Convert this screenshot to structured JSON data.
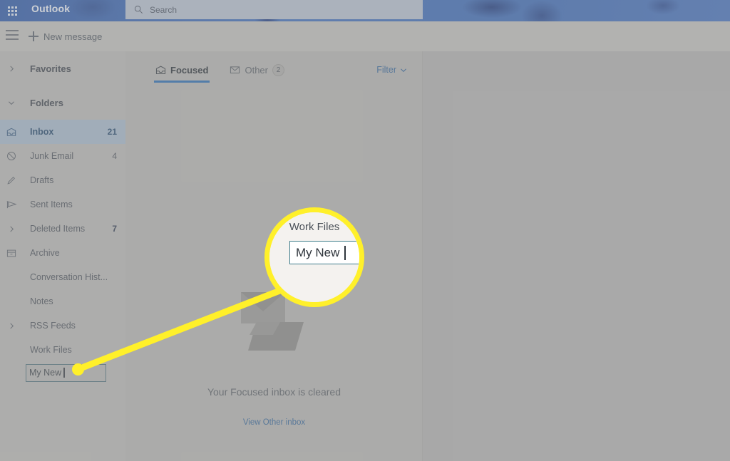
{
  "header": {
    "app_launcher_icon": "grid-apps-icon",
    "brand": "Outlook",
    "search": {
      "icon": "search-icon",
      "placeholder": "Search",
      "value": ""
    },
    "background_color": "#3a67b5"
  },
  "command_bar": {
    "menu_icon": "hamburger-menu-icon",
    "new_message_label": "New message",
    "new_message_icon": "plus-icon"
  },
  "sidebar": {
    "sections": [
      {
        "label": "Favorites",
        "chevron": "chevron-right-icon",
        "expanded": false
      },
      {
        "label": "Folders",
        "chevron": "chevron-down-icon",
        "expanded": true
      }
    ],
    "folders": [
      {
        "label": "Inbox",
        "count": "21",
        "icon": "inbox-icon",
        "selected": true,
        "chevron": null
      },
      {
        "label": "Junk Email",
        "count": "4",
        "icon": "block-circle-icon",
        "selected": false,
        "chevron": null
      },
      {
        "label": "Drafts",
        "count": "",
        "icon": "pencil-icon",
        "selected": false,
        "chevron": null
      },
      {
        "label": "Sent Items",
        "count": "",
        "icon": "send-flag-icon",
        "selected": false,
        "chevron": null
      },
      {
        "label": "Deleted Items",
        "count": "7",
        "icon": null,
        "selected": false,
        "chevron": "chevron-right-icon"
      },
      {
        "label": "Archive",
        "count": "",
        "icon": "archive-box-icon",
        "selected": false,
        "chevron": null
      },
      {
        "label": "Conversation Hist...",
        "count": "",
        "icon": null,
        "selected": false,
        "chevron": null
      },
      {
        "label": "Notes",
        "count": "",
        "icon": null,
        "selected": false,
        "chevron": null
      },
      {
        "label": "RSS Feeds",
        "count": "",
        "icon": null,
        "selected": false,
        "chevron": "chevron-right-icon"
      },
      {
        "label": "Work Files",
        "count": "",
        "icon": null,
        "selected": false,
        "chevron": null
      }
    ],
    "new_folder_input": {
      "value": "My New",
      "has_caret": true,
      "border_color": "#51737f"
    },
    "selected_bg_color": "#a8bccf"
  },
  "message_list": {
    "tabs": [
      {
        "label": "Focused",
        "icon": "focused-inbox-icon",
        "badge": "",
        "active": true
      },
      {
        "label": "Other",
        "icon": "other-inbox-icon",
        "badge": "2",
        "active": false
      }
    ],
    "filter": {
      "label": "Filter",
      "chevron": "chevron-down-icon",
      "color": "#35679c"
    },
    "empty_state": {
      "illustration": "envelope-illustration",
      "title": "Your Focused inbox is cleared",
      "link_label": "View Other inbox",
      "link_color": "#35679c"
    }
  },
  "callout": {
    "magnifier": {
      "border_color": "#fff02a",
      "background": "#f4f2ef",
      "folder_label": "Work Files",
      "input_value": "My New",
      "input_border_color": "#3f7e8c",
      "has_caret": true
    },
    "leader_line_color": "#fff02a"
  }
}
